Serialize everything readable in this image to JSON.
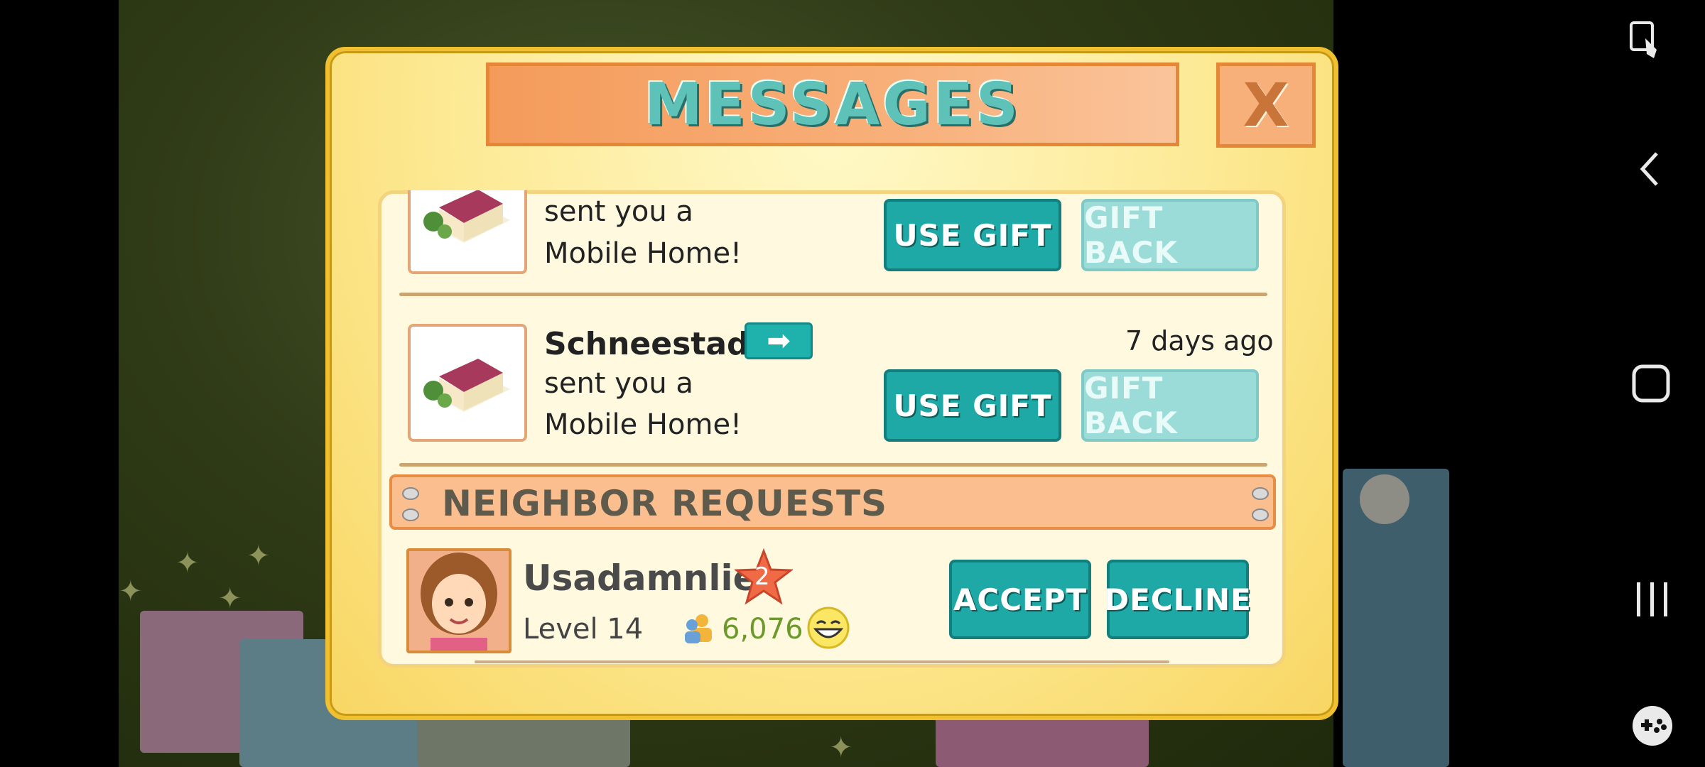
{
  "dialog": {
    "title": "MESSAGES",
    "close_label": "X"
  },
  "messages": [
    {
      "sender": "",
      "line1": "sent you a",
      "line2": "Mobile Home!",
      "time": "",
      "use_gift_label": "USE GIFT",
      "gift_back_label": "GIFT BACK"
    },
    {
      "sender": "Schneestadt",
      "line1": "sent you a",
      "line2": "Mobile Home!",
      "time": "7 days ago",
      "use_gift_label": "USE GIFT",
      "gift_back_label": "GIFT BACK"
    }
  ],
  "neighbor_requests": {
    "header": "NEIGHBOR REQUESTS",
    "items": [
      {
        "name": "Usadamnlie",
        "star_badge": "2",
        "level": "Level 14",
        "population": "6,076",
        "accept_label": "ACCEPT",
        "decline_label": "DECLINE"
      }
    ]
  },
  "system_nav": {
    "icons": [
      "accessibility-icon",
      "back-icon",
      "home-icon",
      "recents-icon",
      "game-tools-icon"
    ]
  },
  "colors": {
    "teal_button": "#1fa9a6",
    "dialog_yellow": "#fde993",
    "header_orange": "#fbbe8f"
  }
}
